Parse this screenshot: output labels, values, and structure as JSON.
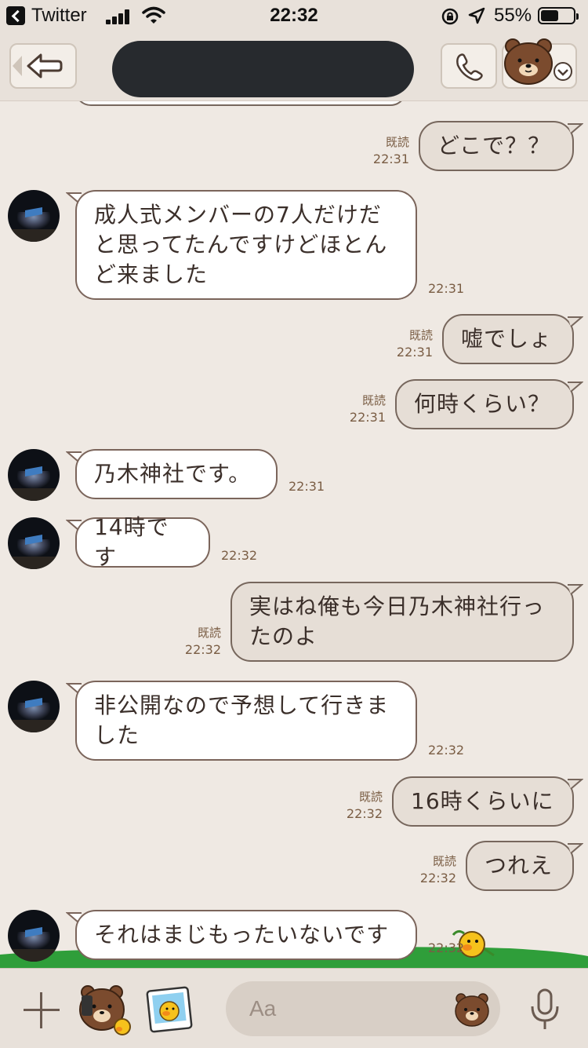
{
  "status_bar": {
    "back_app_label": "Twitter",
    "time": "22:32",
    "battery_percent": "55%",
    "battery_level": 0.55
  },
  "header": {
    "back_icon": "back-arrow-icon",
    "call_icon": "phone-icon",
    "menu_icon": "bear-menu-icon"
  },
  "messages": [
    {
      "dir": "out",
      "text": "どこで？？",
      "read": "既読",
      "time": "22:31"
    },
    {
      "dir": "in",
      "text": "成人式メンバーの7人だけだ\nと思ってたんですけどほとん\nど来ました",
      "time": "22:31"
    },
    {
      "dir": "out",
      "text": "嘘でしょ",
      "read": "既読",
      "time": "22:31"
    },
    {
      "dir": "out",
      "text": "何時くらい？",
      "read": "既読",
      "time": "22:31"
    },
    {
      "dir": "in",
      "text": "乃木神社です。",
      "time": "22:31"
    },
    {
      "dir": "in",
      "text": "14時です",
      "time": "22:32"
    },
    {
      "dir": "out",
      "text": "実はね俺も今日乃木神社行っ\nたのよ",
      "read": "既読",
      "time": "22:32"
    },
    {
      "dir": "in",
      "text": "非公開なので予想して行きま\nした",
      "time": "22:32"
    },
    {
      "dir": "out",
      "text": "16時くらいに",
      "read": "既読",
      "time": "22:32"
    },
    {
      "dir": "out",
      "text": "つれえ",
      "read": "既読",
      "time": "22:32"
    },
    {
      "dir": "in",
      "text": "それはまじもったいないです",
      "time": "22:32"
    }
  ],
  "composer": {
    "placeholder": "Aa",
    "plus_icon": "plus-icon",
    "sticker_icon": "bear-sticker-icon",
    "photo_icon": "photo-icon",
    "emoji_icon": "bear-face-icon",
    "mic_icon": "microphone-icon"
  },
  "colors": {
    "background": "#efe9e3",
    "incoming_bubble": "#ffffff",
    "outgoing_bubble": "#e6ded6",
    "bubble_border": "#7b655b",
    "meta_text": "#7a5d44"
  }
}
